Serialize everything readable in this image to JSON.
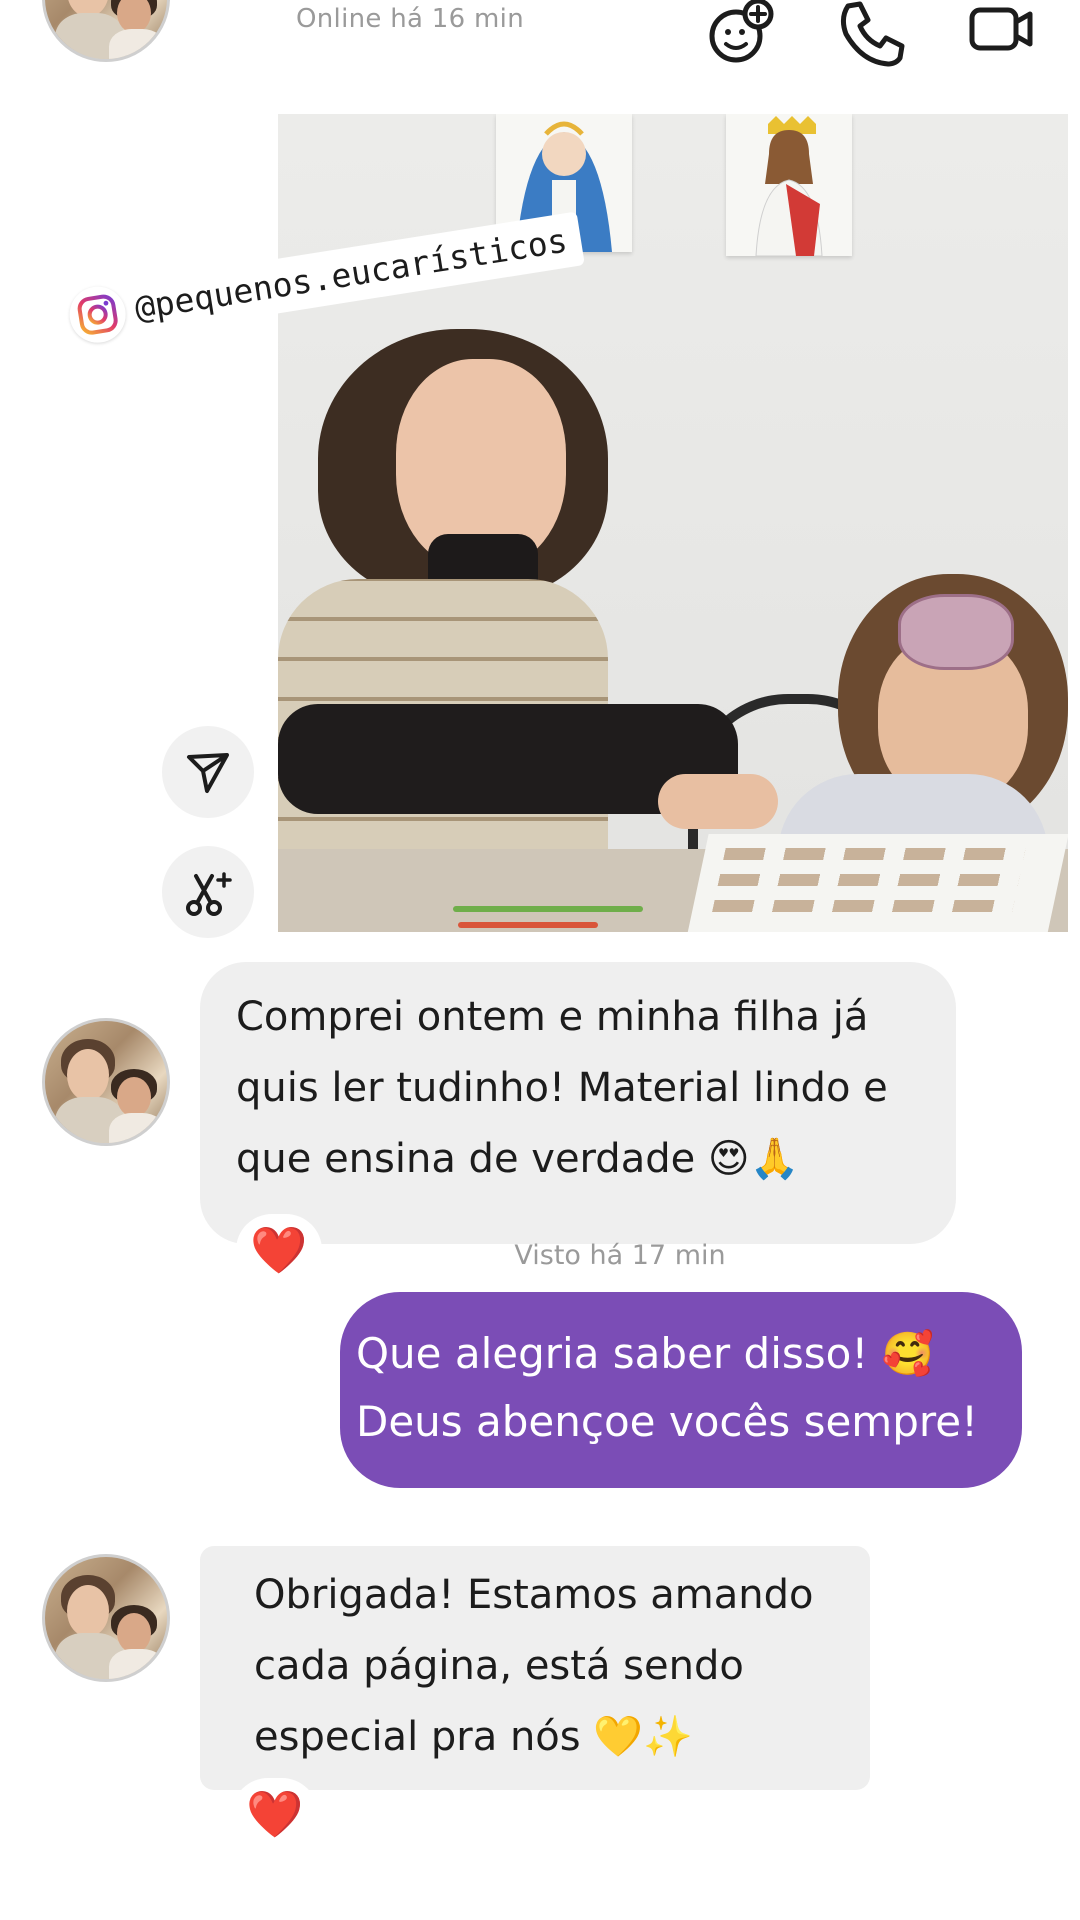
{
  "header": {
    "status": "Online há 16 min",
    "icons": [
      "add-effect-icon",
      "phone-icon",
      "video-camera-icon"
    ]
  },
  "video": {
    "watermark_handle": "@pequenos.eucarísticos",
    "watermark_icon": "instagram-icon"
  },
  "side_actions": [
    "share-icon",
    "scissors-sparkle-icon"
  ],
  "messages": [
    {
      "direction": "incoming",
      "lines": [
        "Comprei ontem e minha filha já",
        "quis ler tudinho! Material lindo e",
        "que ensina de verdade 😍🙏"
      ],
      "reaction": "❤️"
    },
    {
      "direction": "outgoing",
      "seen": "Visto há 17 min",
      "lines": [
        "Que alegria saber disso! 🥰",
        "Deus abençoe vocês sempre!"
      ]
    },
    {
      "direction": "incoming",
      "lines": [
        "Obrigada! Estamos amando",
        "cada página, está sendo",
        "especial pra nós 💛✨"
      ],
      "reaction": "❤️"
    }
  ],
  "colors": {
    "outgoing_bubble": "#7b4db6",
    "incoming_bubble": "#efefef",
    "muted_text": "#9a9a9a"
  }
}
